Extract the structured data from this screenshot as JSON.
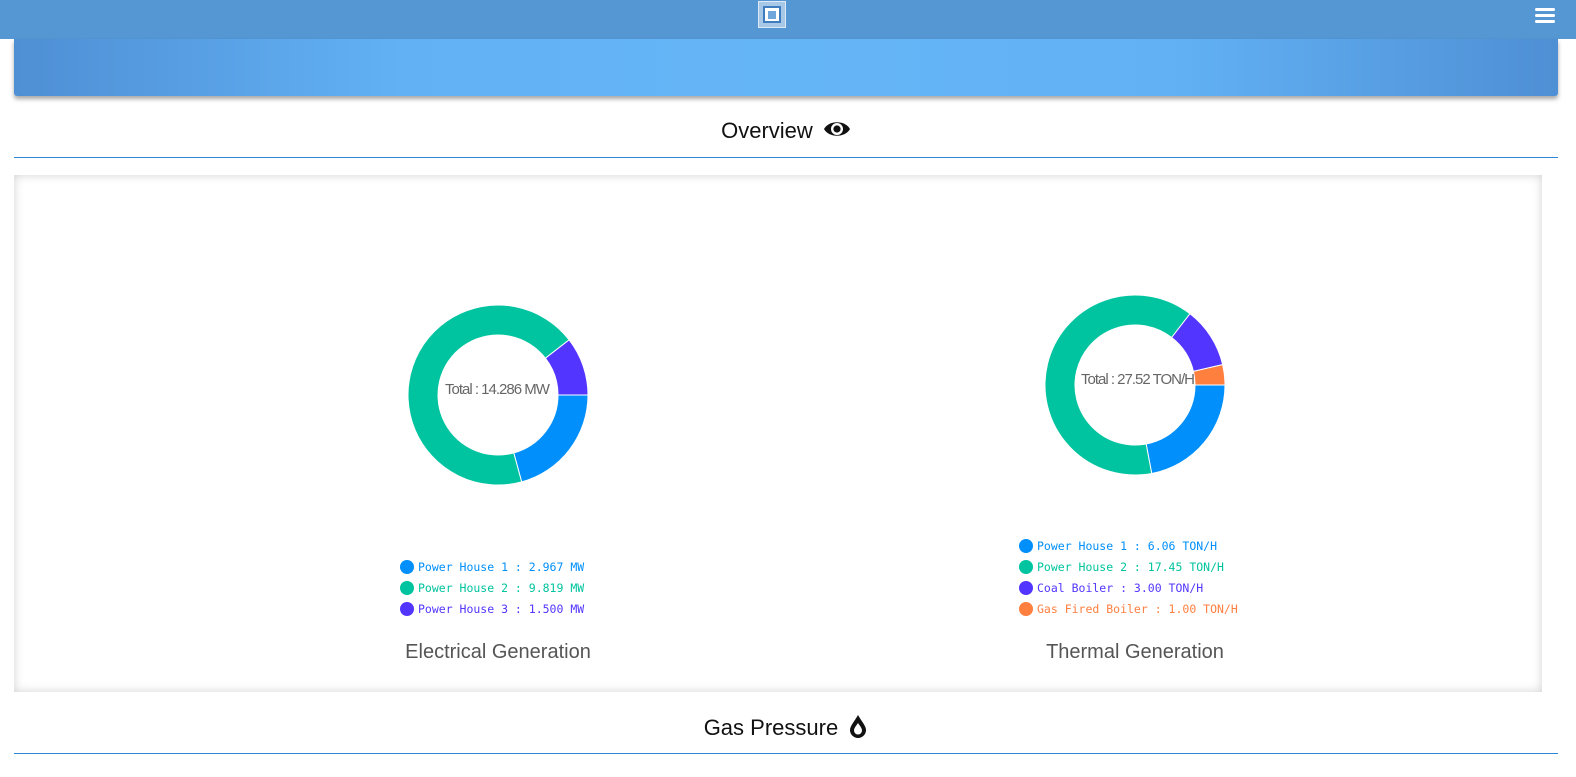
{
  "header": {
    "logo_icon": "app-logo-icon",
    "menu_icon": "hamburger-menu-icon"
  },
  "sections": {
    "overview": {
      "title": "Overview",
      "icon": "eye-icon"
    },
    "gas_pressure": {
      "title": "Gas Pressure",
      "icon": "water-drop-icon"
    }
  },
  "chart_data": [
    {
      "type": "pie",
      "variant": "donut",
      "title": "Electrical Generation",
      "center_text": "Total : 14.286 MW",
      "unit": "MW",
      "start_angle_deg": 0,
      "series": [
        {
          "name": "Power House 1",
          "value": 2.967,
          "label": "Power House 1 : 2.967 MW",
          "color": "#008ffb"
        },
        {
          "name": "Power House 2",
          "value": 9.819,
          "label": "Power House 2 : 9.819 MW",
          "color": "#00c49f"
        },
        {
          "name": "Power House 3",
          "value": 1.5,
          "label": "Power House 3 : 1.500 MW",
          "color": "#5236ff"
        }
      ],
      "legend_position": "bottom"
    },
    {
      "type": "pie",
      "variant": "donut",
      "title": "Thermal Generation",
      "center_text": "Total : 27.52 TON/H",
      "unit": "TON/H",
      "start_angle_deg": 0,
      "series": [
        {
          "name": "Power House 1",
          "value": 6.06,
          "label": "Power House 1 : 6.06 TON/H",
          "color": "#008ffb"
        },
        {
          "name": "Power House 2",
          "value": 17.45,
          "label": "Power House 2 : 17.45 TON/H",
          "color": "#00c49f"
        },
        {
          "name": "Coal Boiler",
          "value": 3.0,
          "label": "Coal Boiler : 3.00 TON/H",
          "color": "#5236ff"
        },
        {
          "name": "Gas Fired Boiler",
          "value": 1.0,
          "label": "Gas Fired Boiler : 1.00 TON/H",
          "color": "#ff7f3f"
        }
      ],
      "legend_position": "bottom"
    }
  ]
}
